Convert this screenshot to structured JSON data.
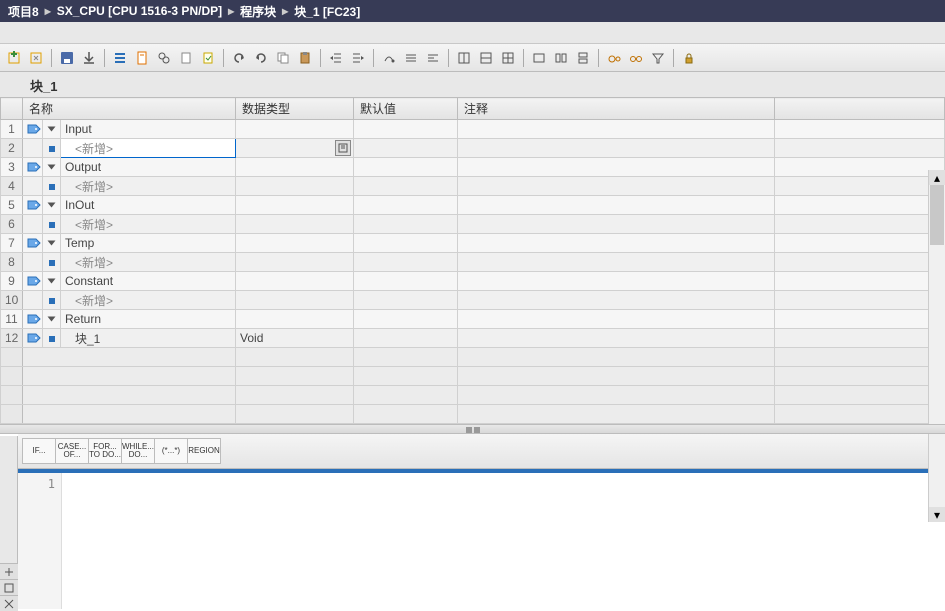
{
  "breadcrumb": {
    "items": [
      "项目8",
      "SX_CPU [CPU 1516-3 PN/DP]",
      "程序块",
      "块_1 [FC23]"
    ]
  },
  "blockTitle": "块_1",
  "columns": {
    "name": "名称",
    "dtype": "数据类型",
    "default": "默认值",
    "comment": "注释"
  },
  "rows": [
    {
      "n": "1",
      "type": "section",
      "label": "Input"
    },
    {
      "n": "2",
      "type": "addnew",
      "label": "<新增>",
      "active": true
    },
    {
      "n": "3",
      "type": "section",
      "label": "Output"
    },
    {
      "n": "4",
      "type": "addnew",
      "label": "<新增>"
    },
    {
      "n": "5",
      "type": "section",
      "label": "InOut"
    },
    {
      "n": "6",
      "type": "addnew",
      "label": "<新增>"
    },
    {
      "n": "7",
      "type": "section",
      "label": "Temp"
    },
    {
      "n": "8",
      "type": "addnew",
      "label": "<新增>"
    },
    {
      "n": "9",
      "type": "section",
      "label": "Constant"
    },
    {
      "n": "10",
      "type": "addnew",
      "label": "<新增>"
    },
    {
      "n": "11",
      "type": "section",
      "label": "Return"
    },
    {
      "n": "12",
      "type": "value",
      "label": "块_1",
      "dtype": "Void"
    }
  ],
  "keywords": [
    {
      "l1": "IF...",
      "l2": ""
    },
    {
      "l1": "CASE...",
      "l2": "OF..."
    },
    {
      "l1": "FOR...",
      "l2": "TO DO..."
    },
    {
      "l1": "WHILE...",
      "l2": "DO..."
    },
    {
      "l1": "(*...*)",
      "l2": ""
    },
    {
      "l1": "REGION",
      "l2": ""
    }
  ],
  "codeLine": "1"
}
